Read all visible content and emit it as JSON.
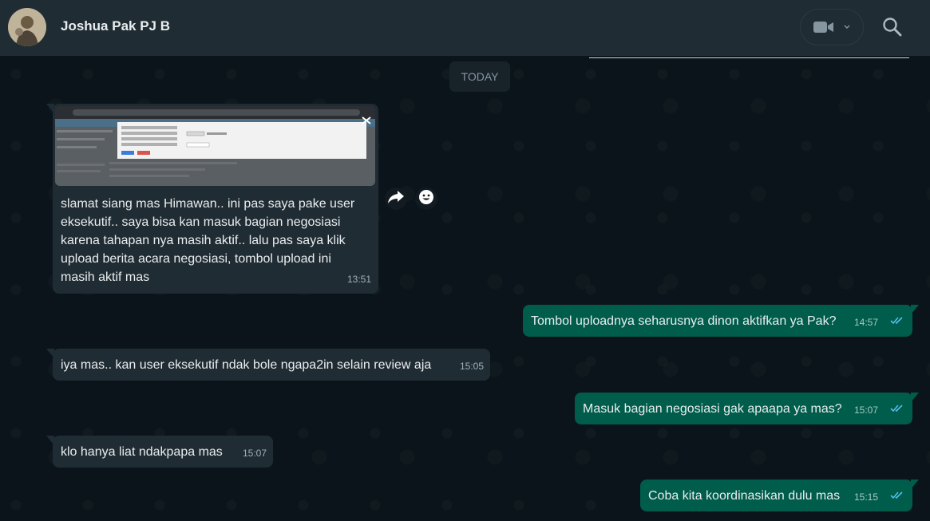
{
  "header": {
    "contact_name": "Joshua Pak PJ B"
  },
  "date_chip": "TODAY",
  "messages": [
    {
      "direction": "incoming",
      "has_image": true,
      "text": "slamat siang mas Himawan.. ini pas saya pake user eksekutif.. saya bisa kan masuk bagian negosiasi karena tahapan nya masih aktif.. lalu pas saya klik upload berita acara negosiasi, tombol upload ini masih aktif mas",
      "lines": [
        "slamat siang mas Himawan.. ini pas saya pake user",
        "eksekutif.. saya bisa kan masuk bagian negosiasi",
        "karena tahapan nya masih aktif.. lalu pas saya klik",
        "upload berita acara negosiasi, tombol upload ini",
        "masih aktif mas"
      ],
      "time": "13:51"
    },
    {
      "direction": "outgoing",
      "text": "Tombol uploadnya seharusnya dinon aktifkan ya Pak?",
      "time": "14:57",
      "status": "read"
    },
    {
      "direction": "incoming",
      "text": "iya mas.. kan user eksekutif ndak bole ngapa2in selain review aja",
      "time": "15:05"
    },
    {
      "direction": "outgoing",
      "text": "Masuk bagian negosiasi gak apaapa ya mas?",
      "time": "15:07",
      "status": "read"
    },
    {
      "direction": "incoming",
      "text": "klo hanya liat ndakpapa mas",
      "time": "15:07"
    },
    {
      "direction": "outgoing",
      "text": "Coba kita koordinasikan dulu mas",
      "time": "15:15",
      "status": "read"
    }
  ],
  "colors": {
    "header_bg": "#202c33",
    "chat_bg": "#0b141a",
    "incoming_bubble": "#202c33",
    "outgoing_bubble": "#005c4b",
    "read_tick": "#53bdeb"
  },
  "icons": {
    "video": "video-camera-icon",
    "dropdown": "chevron-down-icon",
    "search": "search-icon",
    "forward": "forward-icon",
    "emoji": "emoji-icon",
    "ticks": "double-check-icon"
  }
}
